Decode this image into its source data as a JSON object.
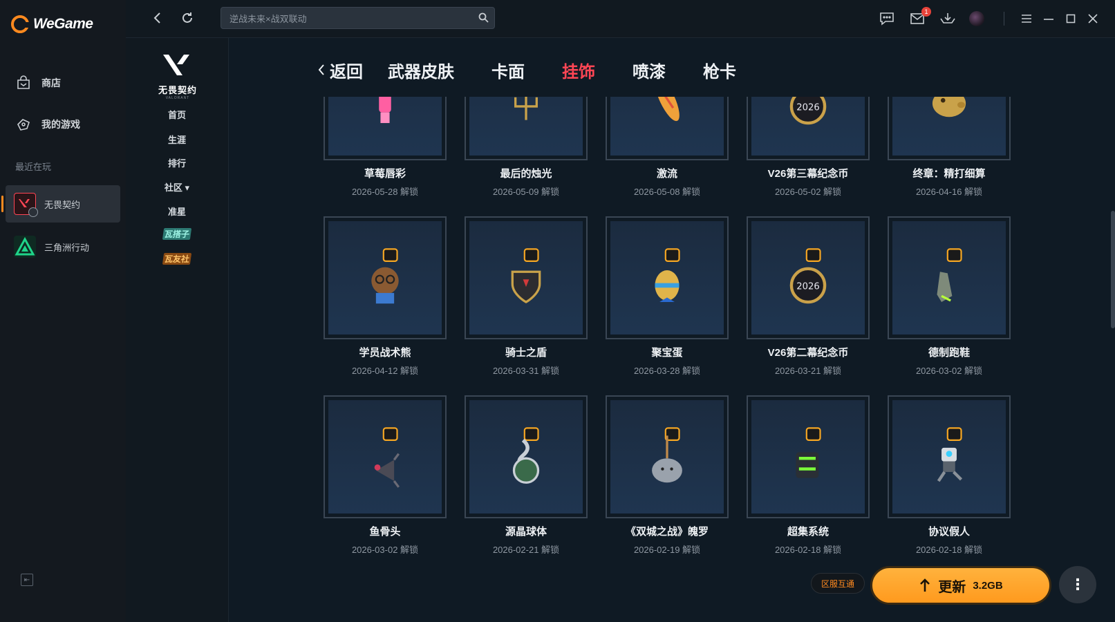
{
  "app": {
    "name": "WeGame"
  },
  "sidebar": {
    "items": [
      {
        "label": "商店",
        "icon": "store-bag-icon"
      },
      {
        "label": "我的游戏",
        "icon": "gamepad-icon"
      }
    ],
    "recent_label": "最近在玩",
    "recent": [
      {
        "label": "无畏契约",
        "icon": "valorant-icon",
        "active": true
      },
      {
        "label": "三角洲行动",
        "icon": "delta-force-icon",
        "active": false
      }
    ]
  },
  "topbar": {
    "search_placeholder": "逆战未来×战双联动",
    "mail_badge": "1"
  },
  "game_nav": {
    "logo_text": "无畏契约",
    "logo_sub": "VALORANT",
    "items": [
      "首页",
      "生涯",
      "排行",
      "社区 ▾",
      "准星"
    ],
    "tag1": "瓦搭子",
    "tag2": "瓦友社"
  },
  "tabs": {
    "back": "返回",
    "items": [
      "武器皮肤",
      "卡面",
      "挂饰",
      "喷漆",
      "枪卡"
    ],
    "active": "挂饰"
  },
  "cards": [
    {
      "name": "草莓唇彩",
      "date": "2026-05-28 解锁",
      "icon": "strawberry-lipstick-charm-icon"
    },
    {
      "name": "最后的烛光",
      "date": "2026-05-09 解锁",
      "icon": "candelabra-charm-icon"
    },
    {
      "name": "激流",
      "date": "2026-05-08 解锁",
      "icon": "surfboard-charm-icon"
    },
    {
      "name": "V26第三幕纪念币",
      "date": "2026-05-02 解锁",
      "icon": "medal-charm-icon"
    },
    {
      "name": "终章：精打细算",
      "date": "2026-04-16 解锁",
      "icon": "piggy-bank-charm-icon"
    },
    {
      "name": "学员战术熊",
      "date": "2026-04-12 解锁",
      "icon": "bear-charm-icon"
    },
    {
      "name": "骑士之盾",
      "date": "2026-03-31 解锁",
      "icon": "shield-charm-icon"
    },
    {
      "name": "聚宝蛋",
      "date": "2026-03-28 解锁",
      "icon": "egg-charm-icon"
    },
    {
      "name": "V26第二幕纪念币",
      "date": "2026-03-21 解锁",
      "icon": "medal-charm-icon"
    },
    {
      "name": "德制跑鞋",
      "date": "2026-03-02 解锁",
      "icon": "sneaker-charm-icon"
    },
    {
      "name": "鱼骨头",
      "date": "2026-03-02 解锁",
      "icon": "fishbone-charm-icon"
    },
    {
      "name": "源晶球体",
      "date": "2026-02-21 解锁",
      "icon": "crystal-orb-charm-icon"
    },
    {
      "name": "《双城之战》魄罗",
      "date": "2026-02-19 解锁",
      "icon": "poro-charm-icon"
    },
    {
      "name": "超集系统",
      "date": "2026-02-18 解锁",
      "icon": "robot-pack-charm-icon"
    },
    {
      "name": "协议假人",
      "date": "2026-02-18 解锁",
      "icon": "dummy-robot-charm-icon"
    }
  ],
  "bottom": {
    "region_chip": "区服互通",
    "update_label": "更新",
    "update_size": "3.2GB"
  },
  "colors": {
    "accent": "#ff8a1f",
    "active_tab": "#ff4655",
    "update": "#ffa62b"
  }
}
